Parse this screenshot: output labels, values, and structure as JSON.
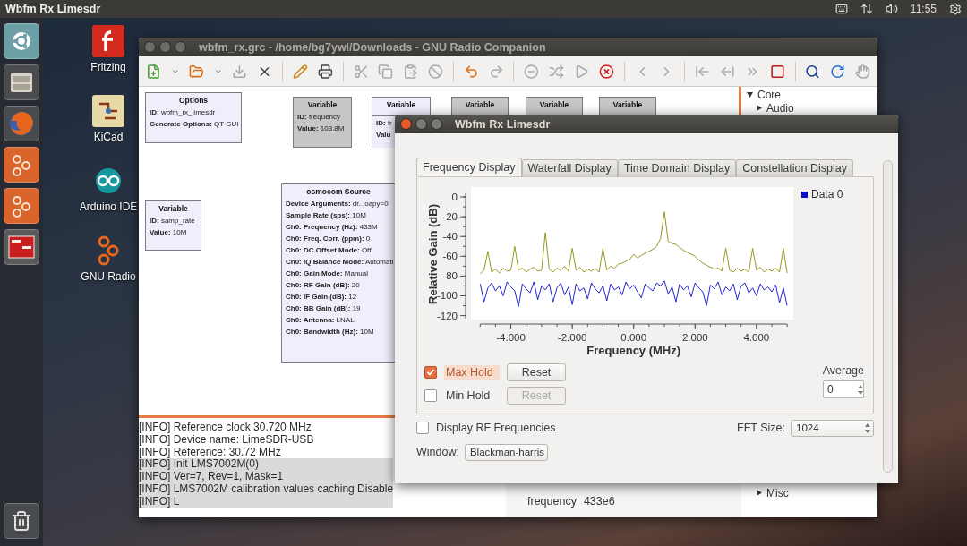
{
  "top_bar": {
    "title": "Wbfm Rx Limesdr",
    "time": "11:55"
  },
  "launcher": [
    {
      "kind": "ubuntu"
    },
    {
      "kind": "files"
    },
    {
      "kind": "firefox"
    },
    {
      "kind": "gnuradio"
    },
    {
      "kind": "gnuradio"
    },
    {
      "kind": "terminal"
    },
    {
      "kind": "trash"
    }
  ],
  "desktop_icons": [
    {
      "kind": "fritzing",
      "label": "Fritzing"
    },
    {
      "kind": "kicad",
      "label": "KiCad"
    },
    {
      "kind": "arduino",
      "label": "Arduino IDE"
    },
    {
      "kind": "gnuradio",
      "label": "GNU Radio"
    }
  ],
  "grc": {
    "title": "wbfm_rx.grc - /home/bg7ywl/Downloads - GNU Radio Companion",
    "blocks": [
      {
        "title": "Options",
        "disabled": false,
        "params": [
          {
            "label": "ID:",
            "value": "wbfm_rx_limesdr"
          },
          {
            "label": "Generate Options:",
            "value": "QT GUI"
          }
        ]
      },
      {
        "title": "Variable",
        "disabled": true,
        "params": [
          {
            "label": "ID:",
            "value": "frequency"
          },
          {
            "label": "Value:",
            "value": "103.8M"
          }
        ]
      },
      {
        "title": "Variable",
        "disabled": false,
        "params": [
          {
            "label": "ID:",
            "value": "fr"
          },
          {
            "label": "Valu"
          }
        ]
      },
      {
        "title": "Variable",
        "disabled": true
      },
      {
        "title": "Variable",
        "disabled": true
      },
      {
        "title": "Variable",
        "disabled": true
      },
      {
        "title": "Variable",
        "disabled": false,
        "params": [
          {
            "label": "ID:",
            "value": "samp_rate"
          },
          {
            "label": "Value:",
            "value": "10M"
          }
        ]
      },
      {
        "title": "osmocom Source",
        "disabled": false,
        "params": [
          {
            "label": "Device Arguments:",
            "value": "dr...oapy=0"
          },
          {
            "label": "Sample Rate (sps):",
            "value": "10M"
          },
          {
            "label": "Ch0: Frequency (Hz):",
            "value": "433M"
          },
          {
            "label": "Ch0: Freq. Corr. (ppm):",
            "value": "0"
          },
          {
            "label": "Ch0: DC Offset Mode:",
            "value": "Off"
          },
          {
            "label": "Ch0: IQ Balance Mode:",
            "value": "Automati"
          },
          {
            "label": "Ch0: Gain Mode:",
            "value": "Manual"
          },
          {
            "label": "Ch0: RF Gain (dB):",
            "value": "20"
          },
          {
            "label": "Ch0: IF Gain (dB):",
            "value": "12"
          },
          {
            "label": "Ch0: BB Gain (dB):",
            "value": "19"
          },
          {
            "label": "Ch0: Antenna:",
            "value": "LNAL"
          },
          {
            "label": "Ch0: Bandwidth (Hz):",
            "value": "10M"
          }
        ]
      }
    ],
    "tree": [
      {
        "label": "Core",
        "expanded": true
      },
      {
        "label": "Audio",
        "expanded": false
      }
    ],
    "tree_bottom": [
      {
        "label": "Misc",
        "expanded": false
      }
    ],
    "console": [
      {
        "text": "[INFO] Reference clock 30.720 MHz",
        "highlighted": false
      },
      {
        "text": "[INFO] Device name: LimeSDR-USB",
        "highlighted": false
      },
      {
        "text": "[INFO] Reference: 30.72 MHz",
        "highlighted": false
      },
      {
        "text": "[INFO] Init LMS7002M(0)",
        "highlighted": true
      },
      {
        "text": "[INFO] Ver=7, Rev=1, Mask=1",
        "highlighted": true
      },
      {
        "text": "[INFO] LMS7002M calibration values caching Disable",
        "highlighted": true
      },
      {
        "text": "[INFO] L",
        "highlighted": true
      }
    ],
    "variables": [
      {
        "name": "frequency",
        "value": "433e6"
      }
    ]
  },
  "plot_window": {
    "title": "Wbfm Rx Limesdr",
    "tabs": [
      {
        "label": "Frequency Display",
        "selected": true
      },
      {
        "label": "Waterfall Display",
        "selected": false
      },
      {
        "label": "Time Domain Display",
        "selected": false
      },
      {
        "label": "Constellation Display",
        "selected": false
      }
    ],
    "plot": {
      "chart_data": {
        "type": "line",
        "xlabel": "Frequency (MHz)",
        "ylabel": "Relative Gain (dB)",
        "xlim": [
          -5.3,
          5.2
        ],
        "ylim": [
          -124,
          10
        ],
        "yticks": [
          0,
          -20,
          -40,
          -60,
          -80,
          -100,
          -120
        ],
        "xticks": [
          {
            "value": -4,
            "label": "-4.000"
          },
          {
            "value": -2,
            "label": "-2.000"
          },
          {
            "value": 0,
            "label": "0.000"
          },
          {
            "value": 2,
            "label": "2.000"
          },
          {
            "value": 4,
            "label": "4.000"
          }
        ],
        "x": [
          -5,
          -4.875,
          -4.75,
          -4.625,
          -4.5,
          -4.375,
          -4.25,
          -4.125,
          -4,
          -3.875,
          -3.75,
          -3.625,
          -3.5,
          -3.375,
          -3.25,
          -3.125,
          -3,
          -2.875,
          -2.75,
          -2.625,
          -2.5,
          -2.375,
          -2.25,
          -2.125,
          -2,
          -1.875,
          -1.75,
          -1.625,
          -1.5,
          -1.375,
          -1.25,
          -1.125,
          -1,
          -0.875,
          -0.75,
          -0.625,
          -0.5,
          -0.375,
          -0.25,
          -0.125,
          0,
          0.125,
          0.25,
          0.375,
          0.5,
          0.625,
          0.75,
          0.875,
          1,
          1.125,
          1.25,
          1.375,
          1.5,
          1.625,
          1.75,
          1.875,
          2,
          2.125,
          2.25,
          2.375,
          2.5,
          2.625,
          2.75,
          2.875,
          3,
          3.125,
          3.25,
          3.375,
          3.5,
          3.625,
          3.75,
          3.875,
          4,
          4.125,
          4.25,
          4.375,
          4.5,
          4.625,
          4.75,
          4.875,
          5
        ],
        "series": [
          {
            "color": "#8c8c0a",
            "values": [
              -78,
              -74,
              -55,
              -76,
              -73,
              -77,
              -72,
              -75,
              -74,
              -50,
              -74,
              -72,
              -76,
              -73,
              -71,
              -75,
              -74,
              -36,
              -73,
              -76,
              -72,
              -74,
              -70,
              -75,
              -52,
              -74,
              -71,
              -76,
              -73,
              -75,
              -72,
              -76,
              -52,
              -74,
              -70,
              -72,
              -68,
              -67,
              -65,
              -63,
              -58,
              -62,
              -59,
              -57,
              -55,
              -53,
              -50,
              -42,
              -15,
              -45,
              -47,
              -48,
              -51,
              -54,
              -56,
              -58,
              -60,
              -64,
              -67,
              -69,
              -71,
              -73,
              -72,
              -75,
              -52,
              -74,
              -76,
              -72,
              -75,
              -73,
              -76,
              -52,
              -74,
              -71,
              -76,
              -73,
              -75,
              -72,
              -76,
              -52,
              -77
            ]
          },
          {
            "name": "Data 0",
            "color": "#0a10c8",
            "values": [
              -88,
              -106,
              -92,
              -87,
              -95,
              -90,
              -100,
              -86,
              -91,
              -95,
              -111,
              -88,
              -93,
              -97,
              -86,
              -104,
              -90,
              -94,
              -88,
              -106,
              -92,
              -87,
              -99,
              -91,
              -109,
              -88,
              -95,
              -92,
              -103,
              -87,
              -93,
              -97,
              -90,
              -105,
              -88,
              -94,
              -91,
              -99,
              -86,
              -93,
              -89,
              -96,
              -102,
              -88,
              -92,
              -95,
              -87,
              -90,
              -85,
              -98,
              -91,
              -106,
              -88,
              -94,
              -90,
              -101,
              -87,
              -92,
              -96,
              -110,
              -89,
              -93,
              -86,
              -99,
              -91,
              -95,
              -88,
              -104,
              -90,
              -87,
              -97,
              -92,
              -100,
              -88,
              -94,
              -91,
              -96,
              -89,
              -107,
              -92,
              -110
            ]
          }
        ]
      }
    },
    "holds": [
      {
        "label": "Max Hold",
        "checked": true,
        "focused": true,
        "reset": {
          "label": "Reset",
          "disabled": false
        }
      },
      {
        "label": "Min Hold",
        "checked": false,
        "focused": false,
        "reset": {
          "label": "Reset",
          "disabled": true
        }
      }
    ],
    "average": {
      "label": "Average",
      "value": "0"
    },
    "display_rf": {
      "label": "Display RF Frequencies",
      "checked": false
    },
    "fft_size": {
      "label": "FFT Size:",
      "value": "1024"
    },
    "window_fn": {
      "label": "Window:",
      "value": "Blackman-harris"
    }
  }
}
